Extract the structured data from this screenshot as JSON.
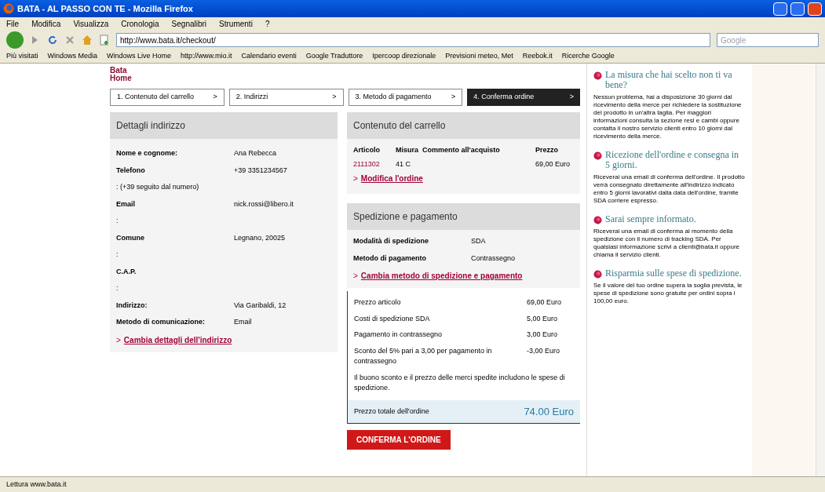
{
  "window": {
    "title": "BATA - AL PASSO CON TE - Mozilla Firefox"
  },
  "menu": [
    "File",
    "Modifica",
    "Visualizza",
    "Cronologia",
    "Segnalibri",
    "Strumenti",
    "?"
  ],
  "address_bar": {
    "value": "http://www.bata.it/checkout/"
  },
  "search": {
    "placeholder": "Google"
  },
  "bookmarks": [
    "Più visitati",
    "Windows Media",
    "Windows Live Home",
    "http://www.mio.it",
    "Calendario eventi",
    "Google Traduttore",
    "Ipercoop direzionale",
    "Previsioni meteo, Met",
    "Reebok.it",
    "Ricerche Google"
  ],
  "logo": {
    "line1": "Bata",
    "line2": "Home"
  },
  "steps": [
    {
      "label": "1. Contenuto del carrello",
      "arrow": ">",
      "selected": false
    },
    {
      "label": "2. Indirizzi",
      "arrow": ">",
      "selected": false
    },
    {
      "label": "3. Metodo di pagamento",
      "arrow": ">",
      "selected": false
    },
    {
      "label": "4. Conferma ordine",
      "arrow": ">",
      "selected": true
    }
  ],
  "address_details": {
    "title": "Dettagli indirizzo",
    "rows": [
      {
        "label": "Nome e cognome:",
        "value": "Ana Rebecca"
      },
      {
        "label": "Telefono",
        "label2": ": (+39 seguito dal numero)",
        "value": "+39 3351234567"
      },
      {
        "label": "Email",
        "label2": ":",
        "value": "nick.rossi@libero.it"
      },
      {
        "label": "Comune",
        "label2": ":",
        "value": "Legnano, 20025"
      },
      {
        "label": "C.A.P.",
        "label2": ":",
        "value": ""
      },
      {
        "label": "Indirizzo:",
        "value": "Via Garibaldi, 12"
      },
      {
        "label": "Metodo di comunicazione:",
        "value": "Email"
      }
    ],
    "link": "Cambia dettagli dell'indirizzo",
    "link_marker": ">"
  },
  "cart": {
    "title": "Contenuto del carrello",
    "columns": [
      "Articolo",
      "Misura",
      "Commento all'acquisto",
      "Prezzo"
    ],
    "rows": [
      [
        "2111302",
        "41 C",
        "",
        "69,00 Euro"
      ]
    ],
    "link": "Modifica l'ordine",
    "link_marker": ">"
  },
  "shipping": {
    "title": "Spedizione e pagamento",
    "rows": [
      {
        "label": "Modalità di spedizione",
        "value": "SDA"
      },
      {
        "label": "Metodo di pagamento",
        "value": "Contrassegno"
      }
    ],
    "link": "Cambia metodo di spedizione e pagamento",
    "link_marker": ">"
  },
  "totals": {
    "rows": [
      {
        "label": "Prezzo articolo",
        "value": "69,00 Euro"
      },
      {
        "label": "Costi di spedizione SDA",
        "value": "5,00 Euro"
      },
      {
        "label": "Pagamento in contrassegno",
        "value": "3,00 Euro"
      },
      {
        "label": "Sconto del 5% pari a 3,00 per pagamento in contrassegno",
        "value": "-3,00 Euro"
      }
    ],
    "note": "Il buono sconto e il prezzo delle merci spedite includono le spese di spedizione.",
    "total_label": "Prezzo totale dell'ordine",
    "total_value": "74.00 Euro"
  },
  "confirm_button": "CONFERMA L'ORDINE",
  "sidebar": [
    {
      "title": "La misura che hai scelto non ti va bene?",
      "text": "Nessun problema, hai a disposizione 30 giorni dal ricevimento della merce per richiedere la sostituzione del prodotto in un'altra taglia. Per maggiori informazioni consulta la sezione resi e cambi oppure contatta il nostro servizio clienti entro 10 giorni dal ricevimento della merce."
    },
    {
      "title": "Ricezione dell'ordine e consegna in 5 giorni.",
      "text": "Riceverai una email di conferma dell'ordine. Il prodotto verrà consegnato direttamente all'indirizzo indicato entro 5 giorni lavorativi dalla data dell'ordine, tramite SDA corriere espresso."
    },
    {
      "title": "Sarai sempre informato.",
      "text": "Riceverai una email di conferma al momento della spedizione con il numero di tracking SDA. Per qualsiasi informazione scrivi a clienti@bata.it oppure chiama il servizio clienti."
    },
    {
      "title": "Risparmia sulle spese di spedizione.",
      "text": "Se il valore del tuo ordine supera la soglia prevista, le spese di spedizione sono gratuite per ordini sopra i 100,00 euro."
    }
  ],
  "status_bar": "Lettura www.bata.it"
}
